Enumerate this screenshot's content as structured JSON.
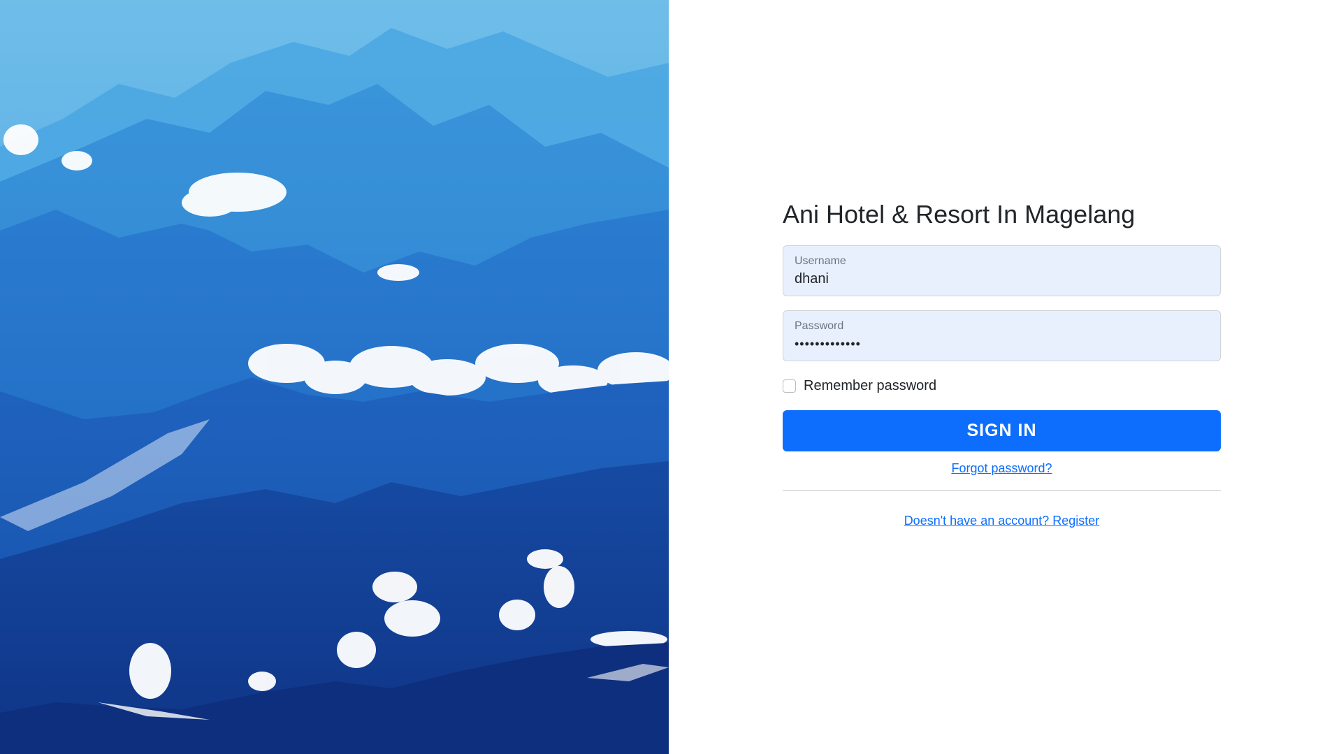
{
  "hero": {
    "icon": "mountain-landscape-photo",
    "colors": {
      "sky": "#56aee4",
      "mid": "#1c6cc6",
      "deep": "#10388e",
      "cloud": "#ffffff"
    }
  },
  "login": {
    "title": "Ani Hotel & Resort In Magelang",
    "username": {
      "label": "Username",
      "value": "dhani"
    },
    "password": {
      "label": "Password",
      "value": "•••••••••••••"
    },
    "remember_label": "Remember password",
    "remember_checked": false,
    "signin_label": "SIGN IN",
    "forgot_label": "Forgot password?",
    "register_label": "Doesn't have an account? Register"
  },
  "colors": {
    "primary": "#0d6efd",
    "field_bg": "#e8f0fe",
    "text": "#212529",
    "muted": "#6c757d"
  }
}
